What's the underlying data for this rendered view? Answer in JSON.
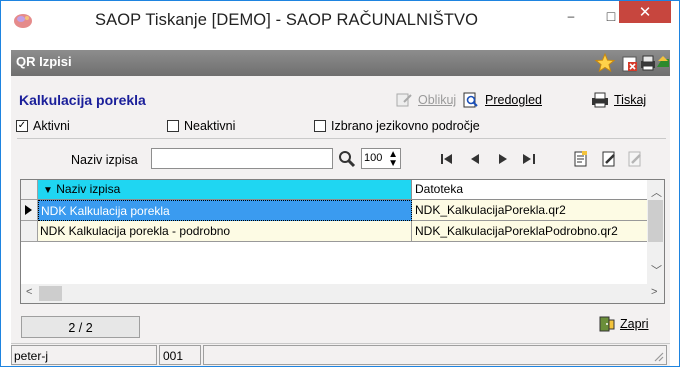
{
  "window": {
    "title": "SAOP Tiskanje [DEMO] - SAOP RAČUNALNIŠTVO",
    "minimize_glyph": "–",
    "maximize_glyph": "□",
    "close_glyph": "✕"
  },
  "section": {
    "title": "QR Izpisi"
  },
  "form": {
    "title": "Kalkulacija porekla",
    "actions": {
      "oblikuj": "Oblikuj",
      "predogled": "Predogled",
      "tiskaj": "Tiskaj"
    },
    "checkboxes": [
      {
        "label": "Aktivni",
        "checked": true
      },
      {
        "label": "Neaktivni",
        "checked": false
      },
      {
        "label": "Izbrano jezikovno področje",
        "checked": false
      }
    ]
  },
  "search": {
    "label": "Naziv izpisa",
    "value": "",
    "limit": "100"
  },
  "grid": {
    "columns": [
      "Naziv izpisa",
      "Datoteka"
    ],
    "rows": [
      {
        "name": "NDK Kalkulacija porekla",
        "file": "NDK_KalkulacijaPorekla.qr2"
      },
      {
        "name": "NDK Kalkulacija porekla - podrobno",
        "file": "NDK_KalkulacijaPoreklaPodrobno.qr2"
      }
    ],
    "sort_glyph": "▼"
  },
  "footer": {
    "counter": "2 / 2",
    "close_label": "Zapri"
  },
  "status": {
    "user": "peter-j",
    "code": "001"
  },
  "colors": {
    "accent_header": "#1fd6f2",
    "selected_row": "#3a9bf0",
    "title_blue": "#1a1f9a",
    "close_red": "#c7463e"
  },
  "icons": [
    "app-icon",
    "star-icon",
    "delete-icon",
    "printer-settings-icon",
    "export-icon",
    "search-icon",
    "first-icon",
    "prev-icon",
    "next-icon",
    "last-icon",
    "document-icon",
    "edit-icon",
    "disabled-edit-icon",
    "preview-icon",
    "print-icon",
    "design-icon",
    "close-door-icon"
  ]
}
